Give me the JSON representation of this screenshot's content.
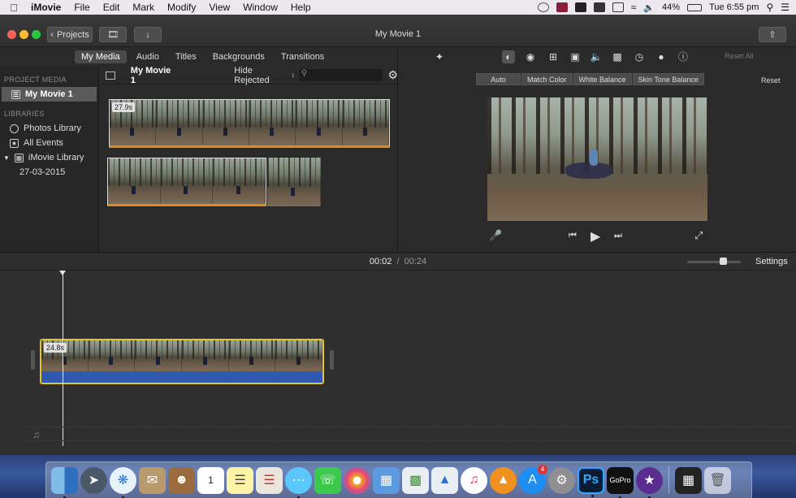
{
  "menubar": {
    "app": "iMovie",
    "items": [
      "File",
      "Edit",
      "Mark",
      "Modify",
      "View",
      "Window",
      "Help"
    ],
    "battery": "44%",
    "clock": "Tue 6:55 pm"
  },
  "titlebar": {
    "projects_label": "Projects",
    "title": "My Movie 1"
  },
  "library": {
    "tabs": [
      "My Media",
      "Audio",
      "Titles",
      "Backgrounds",
      "Transitions"
    ],
    "active_tab": "My Media",
    "project_media_heading": "PROJECT MEDIA",
    "project_item": "My Movie 1",
    "libraries_heading": "LIBRARIES",
    "library_items": [
      "Photos Library",
      "All Events",
      "iMovie Library"
    ],
    "event_date": "27-03-2015",
    "browser_title": "My Movie 1",
    "filter": "Hide Rejected",
    "clip_duration": "27.9s"
  },
  "viewer": {
    "reset_all": "Reset All",
    "color_buttons": [
      "Auto",
      "Match Color",
      "White Balance",
      "Skin Tone Balance"
    ],
    "reset": "Reset"
  },
  "timeline": {
    "current_time": "00:02",
    "separator": "/",
    "total_time": "00:24",
    "settings_label": "Settings",
    "clip_duration": "24.8s",
    "zoom_level": 0.6
  },
  "dock": {
    "app_store_badge": "4"
  },
  "colors": {
    "selection_yellow": "#e2c62a",
    "audio_blue": "#2f5ab0",
    "filmstrip_orange": "#e08a1e"
  }
}
